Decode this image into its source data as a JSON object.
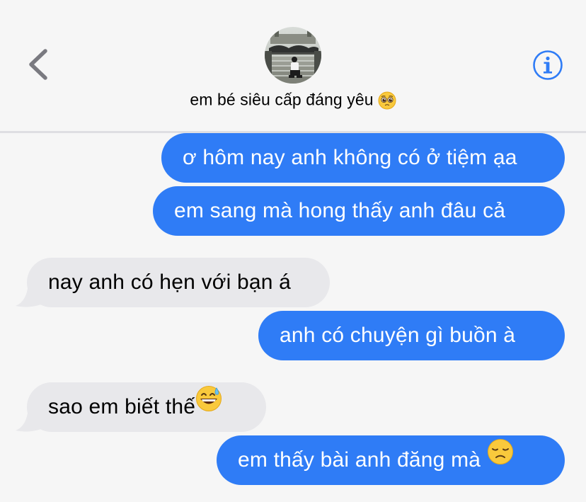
{
  "header": {
    "contact_name": "em bé siêu cấp đáng yêu",
    "name_emoji": "pleading-face-emoji"
  },
  "icons": {
    "back": "chevron-left-icon",
    "info": "info-circle-icon"
  },
  "colors": {
    "outgoing_bubble": "#2f7cf6",
    "incoming_bubble": "#e8e8eb",
    "accent": "#2f7cf6",
    "background": "#f6f6f6"
  },
  "messages": [
    {
      "direction": "outgoing",
      "text": "ơ hôm nay anh không có ở tiệm ạa"
    },
    {
      "direction": "outgoing",
      "text": "em sang mà hong thấy anh đâu cả"
    },
    {
      "direction": "incoming",
      "text": "nay anh có hẹn với bạn á"
    },
    {
      "direction": "outgoing",
      "text": "anh có chuyện gì buồn à"
    },
    {
      "direction": "incoming",
      "text": "sao em biết thế",
      "emoji": "grinning-sweat-emoji"
    },
    {
      "direction": "outgoing",
      "text": "em thấy bài anh đăng mà",
      "emoji": "disappointed-face-emoji"
    }
  ]
}
